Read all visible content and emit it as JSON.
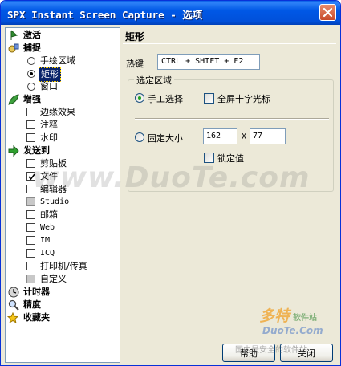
{
  "window": {
    "title": "SPX Instant Screen Capture - 选项"
  },
  "tree": {
    "activate": "激活",
    "capture": "捕捉",
    "capture_items": [
      "手绘区域",
      "矩形",
      "窗口"
    ],
    "enhance": "增强",
    "enhance_items": [
      "边缘效果",
      "注释",
      "水印"
    ],
    "send_to": "发送到",
    "send_items": [
      "剪贴板",
      "文件",
      "编辑器",
      "Studio",
      "邮箱",
      "Web",
      "IM",
      "ICQ",
      "打印机/传真",
      "自定义"
    ],
    "timer": "计时器",
    "precision": "精度",
    "favorites": "收藏夹"
  },
  "panel": {
    "title": "矩形",
    "hotkey_label": "热键",
    "hotkey_value": "CTRL + SHIFT + F2",
    "group_title": "选定区域",
    "manual_select": "手工选择",
    "fullscreen_crosshair": "全屏十字光标",
    "fixed_size": "固定大小",
    "width": "162",
    "x_sep": "X",
    "height": "77",
    "lock_value": "锁定值"
  },
  "buttons": {
    "help": "帮助",
    "close": "关闭"
  },
  "watermark": {
    "main": "www.DuoTe.com",
    "logo_big": "多特",
    "logo_small": "软件站",
    "logo_url": "DuoTe.Com",
    "tagline": "国内最安全的软件站"
  },
  "colors": {
    "titlebar": "#0058E6",
    "dialog_bg": "#ECE9D8",
    "selection": "#0A246A"
  }
}
